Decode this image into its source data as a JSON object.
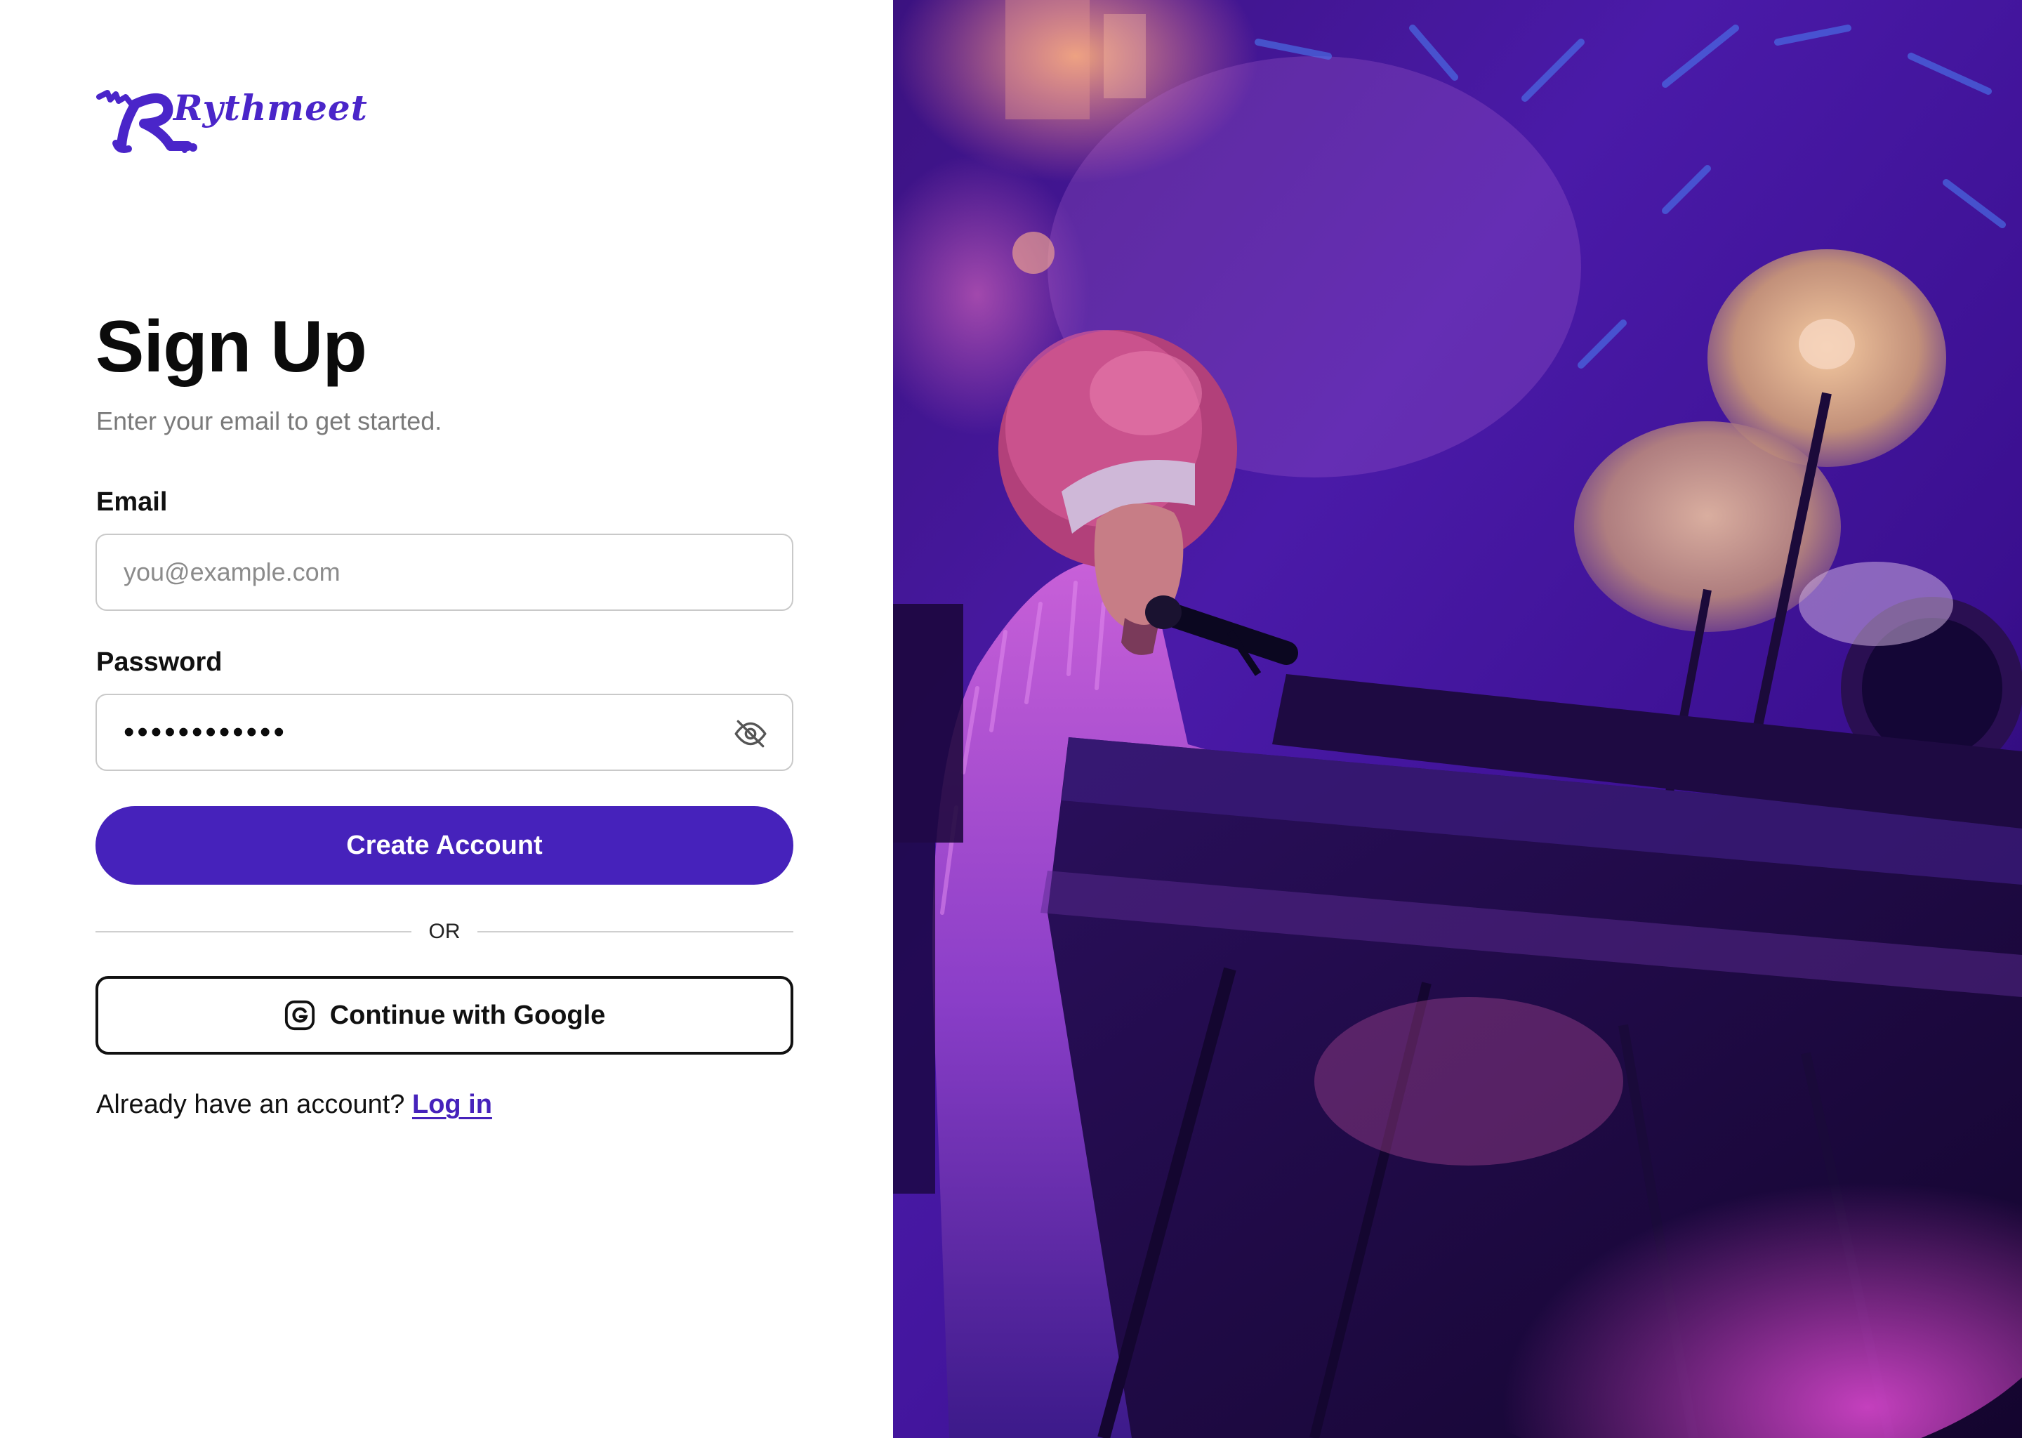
{
  "brand": {
    "name": "Rythmeet",
    "logo_icon": "guitar-r-logo",
    "accent_color": "#4622bb"
  },
  "signup": {
    "title": "Sign Up",
    "subtitle": "Enter your email to get started.",
    "email": {
      "label": "Email",
      "placeholder": "you@example.com",
      "value": ""
    },
    "password": {
      "label": "Password",
      "value": "••••••••••••",
      "toggle_icon": "eye-off-icon"
    },
    "submit_label": "Create Account",
    "divider_text": "OR",
    "google": {
      "label": "Continue with Google",
      "icon": "google-icon"
    },
    "footer": {
      "prompt": "Already have an account?",
      "link_label": "Log in"
    }
  },
  "hero": {
    "image": "concert-keyboardist-photo"
  }
}
